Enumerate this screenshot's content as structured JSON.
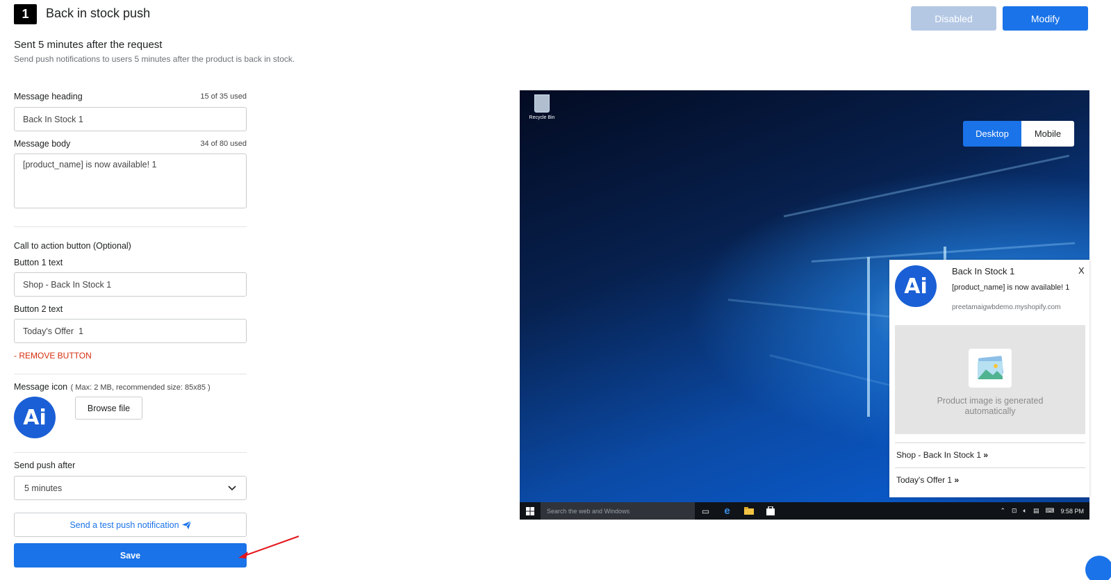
{
  "header": {
    "step_number": "1",
    "title": "Back in stock push",
    "disabled_label": "Disabled",
    "modify_label": "Modify"
  },
  "section": {
    "title": "Sent 5 minutes after the request",
    "description": "Send push notifications to users 5 minutes after the product is back in stock."
  },
  "form": {
    "heading_label": "Message heading",
    "heading_counter": "15 of 35 used",
    "heading_value": "Back In Stock 1",
    "body_label": "Message body",
    "body_counter": "34 of 80 used",
    "body_value": "[product_name] is now available! 1",
    "cta_label": "Call to action button (Optional)",
    "button1_label": "Button 1 text",
    "button1_value": "Shop - Back In Stock 1",
    "button2_label": "Button 2 text",
    "button2_value": "Today's Offer  1",
    "remove_button_label": "- REMOVE BUTTON",
    "icon_label": "Message icon",
    "icon_hint": "( Max: 2 MB, recommended size: 85x85 )",
    "icon_text": "Ai",
    "browse_label": "Browse file",
    "send_after_label": "Send push after",
    "send_after_value": "5 minutes",
    "test_button_label": "Send a test push notification",
    "save_label": "Save"
  },
  "preview": {
    "recycle_bin_label": "Recycle Bin",
    "tab_desktop": "Desktop",
    "tab_mobile": "Mobile",
    "taskbar_search": "Search the web and Windows",
    "clock": "9:58 PM",
    "notification": {
      "icon_text": "Ai",
      "title": "Back In Stock 1",
      "body": "[product_name] is now available! 1",
      "url": "preetamaigwbdemo.myshopify.com",
      "close": "X",
      "image_caption": "Product image is generated automatically",
      "action1": "Shop - Back In Stock 1",
      "action2": "Today's Offer 1",
      "action_chevron": "»"
    }
  },
  "colors": {
    "primary": "#1a73e8",
    "disabled": "#b4c8e4",
    "danger": "#d72c0d",
    "logo": "#1a5fd6"
  }
}
